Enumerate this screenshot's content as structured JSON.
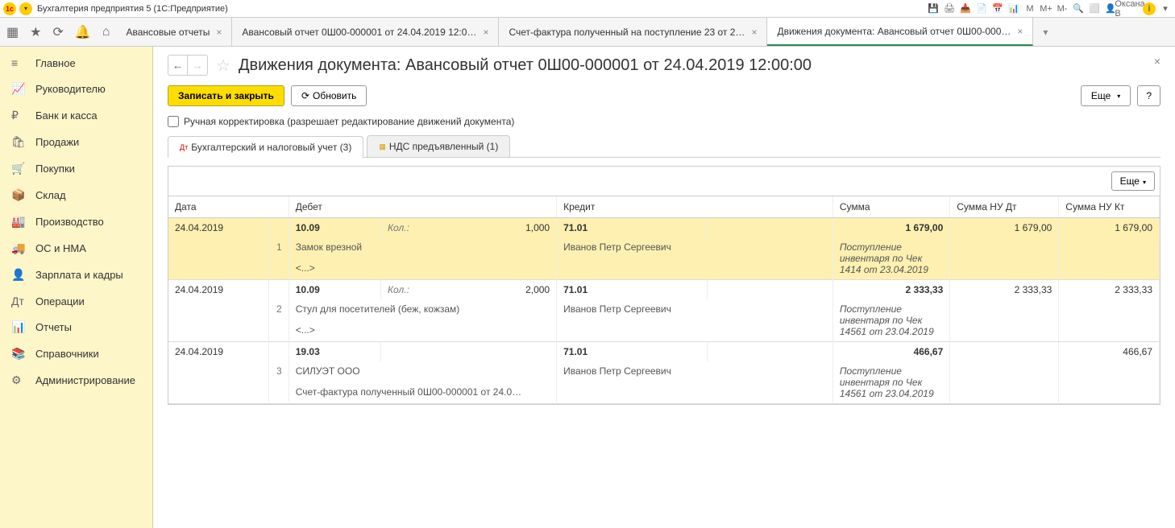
{
  "titlebar": {
    "logo_text": "1с",
    "dropdown": "▾",
    "app_title": "Бухгалтерия предприятия 5   (1С:Предприятие)",
    "user": "Оксана В",
    "icons": [
      "💾",
      "🖨",
      "📥",
      "📄",
      "📅",
      "📊",
      "M",
      "M+",
      "M-",
      "🔍",
      "⬜"
    ]
  },
  "tabbar": {
    "icons": [
      "▦",
      "★",
      "⟳",
      "🔔",
      "⌂"
    ],
    "tabs": [
      {
        "label": "Авансовые отчеты",
        "active": false
      },
      {
        "label": "Авансовый отчет 0Ш00-000001 от 24.04.2019 12:0…",
        "active": false
      },
      {
        "label": "Счет-фактура полученный на поступление 23 от 2…",
        "active": false
      },
      {
        "label": "Движения документа: Авансовый отчет 0Ш00-000…",
        "active": true
      }
    ]
  },
  "sidebar": {
    "items": [
      {
        "icon": "≡",
        "label": "Главное"
      },
      {
        "icon": "📈",
        "label": "Руководителю"
      },
      {
        "icon": "₽",
        "label": "Банк и касса"
      },
      {
        "icon": "🛍",
        "label": "Продажи"
      },
      {
        "icon": "🛒",
        "label": "Покупки"
      },
      {
        "icon": "📦",
        "label": "Склад"
      },
      {
        "icon": "🏭",
        "label": "Производство"
      },
      {
        "icon": "🚚",
        "label": "ОС и НМА"
      },
      {
        "icon": "👤",
        "label": "Зарплата и кадры"
      },
      {
        "icon": "Дт",
        "label": "Операции"
      },
      {
        "icon": "📊",
        "label": "Отчеты"
      },
      {
        "icon": "📚",
        "label": "Справочники"
      },
      {
        "icon": "⚙",
        "label": "Администрирование"
      }
    ]
  },
  "content": {
    "page_title": "Движения документа: Авансовый отчет 0Ш00-000001 от 24.04.2019 12:00:00",
    "btn_save_close": "Записать и закрыть",
    "btn_refresh": "Обновить",
    "btn_more": "Еще",
    "btn_help": "?",
    "checkbox_label": "Ручная корректировка (разрешает редактирование движений документа)",
    "sub_tabs": [
      {
        "label": "Бухгалтерский и налоговый учет (3)",
        "active": true,
        "icon_color": "#d00"
      },
      {
        "label": "НДС предъявленный (1)",
        "active": false,
        "icon_color": "#e0a000"
      }
    ],
    "table": {
      "btn_more": "Еще",
      "headers": {
        "date": "Дата",
        "debit": "Дебет",
        "credit": "Кредит",
        "sum": "Сумма",
        "sum_nu_dt": "Сумма НУ Дт",
        "sum_nu_kt": "Сумма НУ Кт"
      },
      "rows": [
        {
          "selected": true,
          "date": "24.04.2019",
          "num": "1",
          "debit_acc": "10.09",
          "qty_label": "Кол.:",
          "qty": "1,000",
          "debit_desc1": "Замок врезной",
          "debit_desc2": "<...>",
          "credit_acc": "71.01",
          "credit_desc": "Иванов Петр Сергеевич",
          "sum": "1 679,00",
          "sum_desc": "Поступление инвентаря по Чек 1414 от 23.04.2019",
          "nu_dt": "1 679,00",
          "nu_kt": "1 679,00"
        },
        {
          "selected": false,
          "date": "24.04.2019",
          "num": "2",
          "debit_acc": "10.09",
          "qty_label": "Кол.:",
          "qty": "2,000",
          "debit_desc1": "Стул для посетителей (беж, кожзам)",
          "debit_desc2": "<...>",
          "credit_acc": "71.01",
          "credit_desc": "Иванов Петр Сергеевич",
          "sum": "2 333,33",
          "sum_desc": "Поступление инвентаря по Чек 14561 от 23.04.2019",
          "nu_dt": "2 333,33",
          "nu_kt": "2 333,33"
        },
        {
          "selected": false,
          "date": "24.04.2019",
          "num": "3",
          "debit_acc": "19.03",
          "qty_label": "",
          "qty": "",
          "debit_desc1": "СИЛУЭТ ООО",
          "debit_desc2": "Счет-фактура полученный 0Ш00-000001 от 24.0…",
          "credit_acc": "71.01",
          "credit_desc": "Иванов Петр Сергеевич",
          "sum": "466,67",
          "sum_desc": "Поступление инвентаря по Чек 14561 от 23.04.2019",
          "nu_dt": "",
          "nu_kt": "466,67"
        }
      ]
    }
  }
}
